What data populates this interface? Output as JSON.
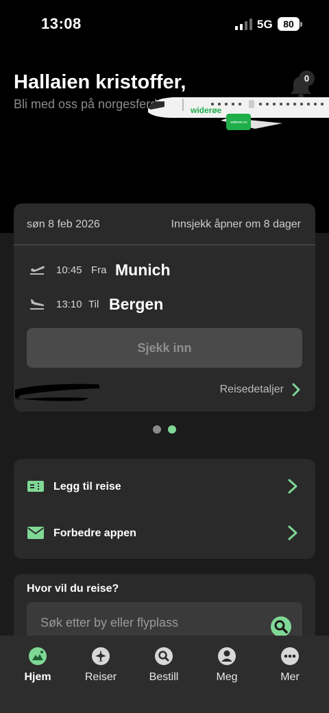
{
  "status_bar": {
    "time": "13:08",
    "network": "5G",
    "battery": "80"
  },
  "header": {
    "greeting": "Hallaien kristoffer,",
    "subtitle": "Bli med oss på norgesferd",
    "notification_count": "0",
    "plane_livery": "widerøe",
    "plane_engine_text": "widerøe.no"
  },
  "flight_card": {
    "date": "søn 8 feb 2026",
    "checkin_info": "Innsjekk åpner om 8 dager",
    "departure": {
      "time": "10:45",
      "label": "Fra",
      "city": "Munich",
      "icon": "takeoff-icon"
    },
    "arrival": {
      "time": "13:10",
      "label": "Til",
      "city": "Bergen",
      "icon": "landing-icon"
    },
    "checkin_button": "Sjekk inn",
    "details_link": "Reisedetaljer"
  },
  "pager": {
    "count": 2,
    "active_index": 1
  },
  "actions": [
    {
      "label": "Legg til reise",
      "icon": "ticket-icon"
    },
    {
      "label": "Forbedre appen",
      "icon": "envelope-icon"
    }
  ],
  "search": {
    "title": "Hvor vil du reise?",
    "placeholder": "Søk etter by eller flyplass"
  },
  "nav": {
    "items": [
      {
        "label": "Hjem",
        "icon": "home-icon",
        "active": true
      },
      {
        "label": "Reiser",
        "icon": "plane-icon",
        "active": false
      },
      {
        "label": "Bestill",
        "icon": "search-icon",
        "active": false
      },
      {
        "label": "Meg",
        "icon": "person-icon",
        "active": false
      },
      {
        "label": "Mer",
        "icon": "more-icon",
        "active": false
      }
    ]
  },
  "colors": {
    "accent": "#7fd896",
    "brand_green": "#1fae4a",
    "background": "#000000",
    "card": "#2a2a2a",
    "nav": "#2d2d2d"
  }
}
